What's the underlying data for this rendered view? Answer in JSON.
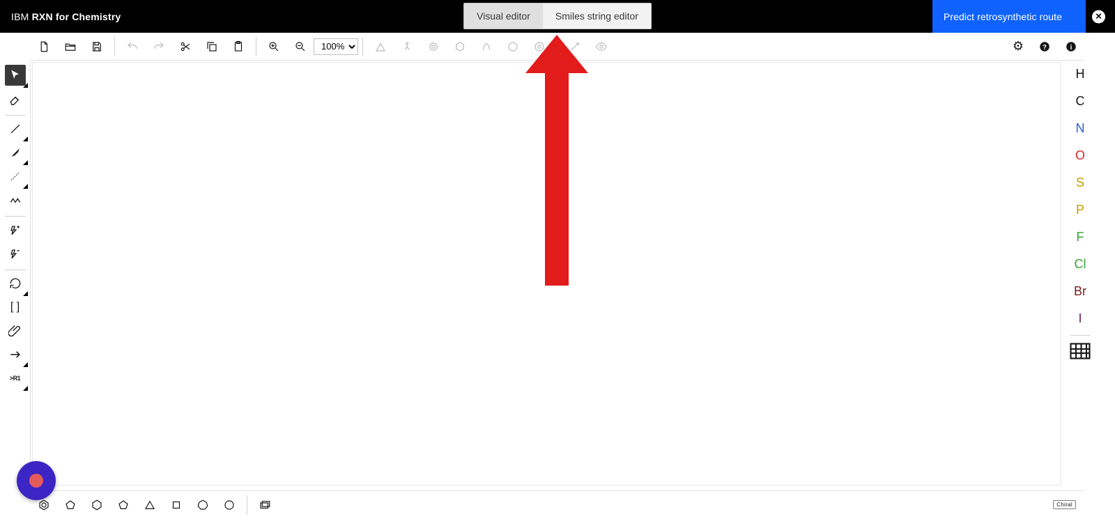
{
  "brand": {
    "prefix": "IBM",
    "suffix": "RXN for Chemistry"
  },
  "tabs": {
    "visual": "Visual editor",
    "smiles": "Smiles string editor"
  },
  "primary_action": "Predict retrosynthetic route",
  "zoom": {
    "value": "100%"
  },
  "atoms": [
    {
      "sym": "H",
      "color": "#161616"
    },
    {
      "sym": "C",
      "color": "#161616"
    },
    {
      "sym": "N",
      "color": "#2e5fd1"
    },
    {
      "sym": "O",
      "color": "#d62728"
    },
    {
      "sym": "S",
      "color": "#c99a00"
    },
    {
      "sym": "P",
      "color": "#c99a00"
    },
    {
      "sym": "F",
      "color": "#3aa33a"
    },
    {
      "sym": "Cl",
      "color": "#3aa33a"
    },
    {
      "sym": "Br",
      "color": "#7a1f1f"
    },
    {
      "sym": "I",
      "color": "#6b1d5c"
    }
  ],
  "rlabel": ">R1",
  "bottom": {
    "chiral": "Chiral"
  }
}
